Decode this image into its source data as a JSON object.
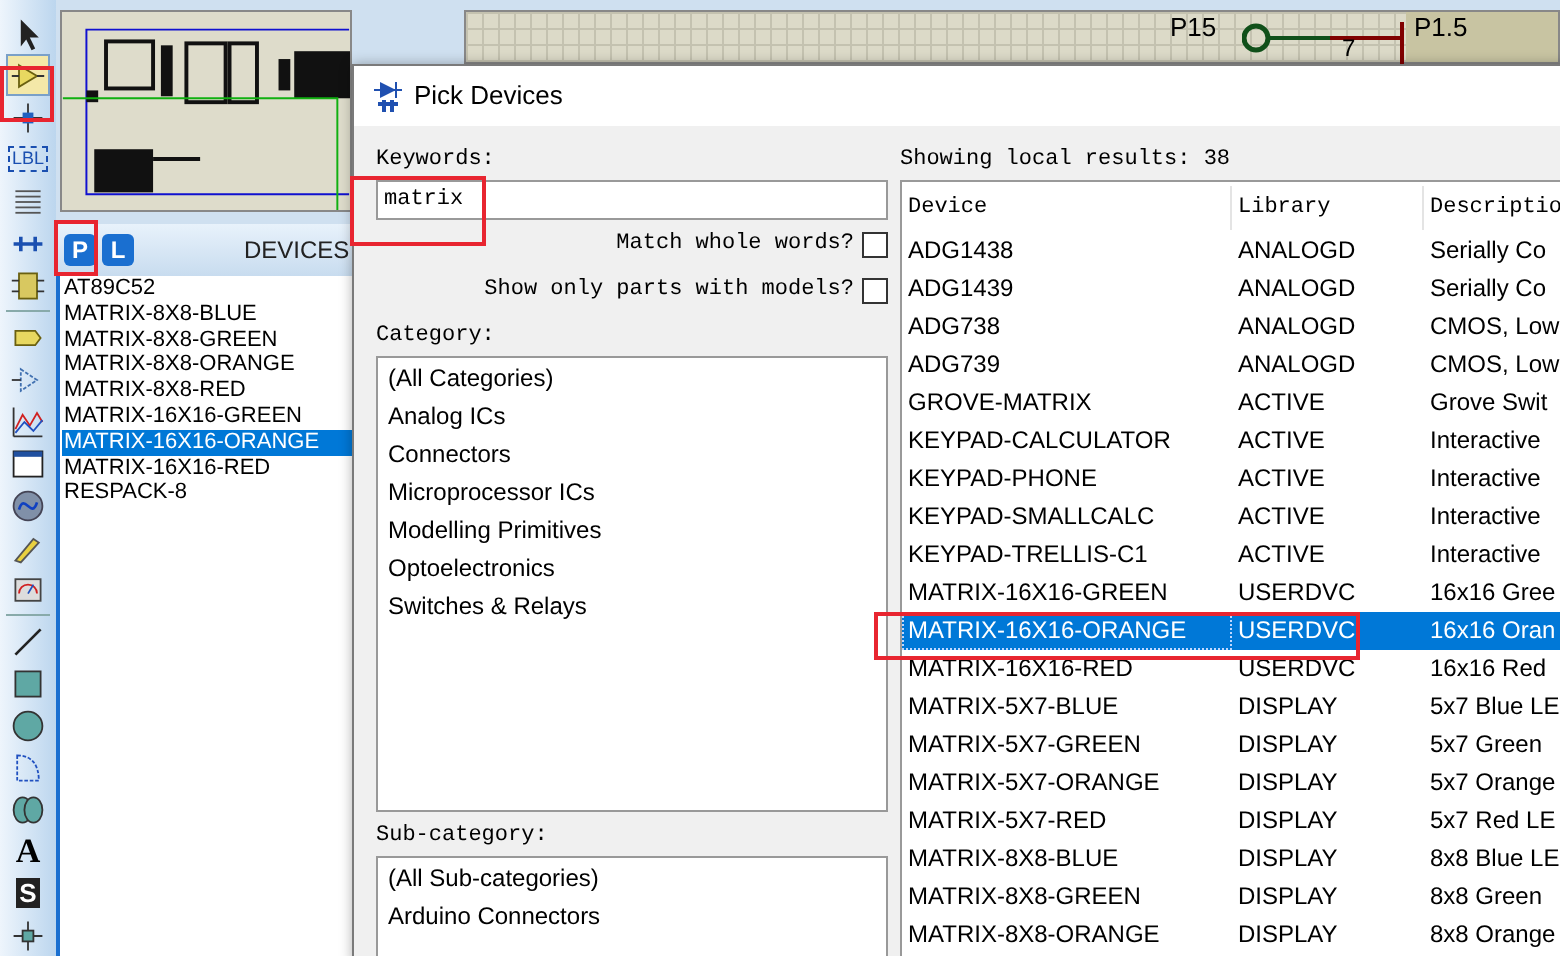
{
  "toolbar": {
    "items": [
      {
        "kind": "pointer",
        "selected": false
      },
      {
        "kind": "component",
        "selected": true
      },
      {
        "kind": "junction",
        "selected": false
      },
      {
        "kind": "label",
        "text": "LBL",
        "selected": false
      },
      {
        "kind": "script",
        "selected": false
      },
      {
        "kind": "bus",
        "selected": false
      },
      {
        "kind": "subcircuit",
        "selected": false
      },
      {
        "kind": "separator"
      },
      {
        "kind": "terminal",
        "selected": false
      },
      {
        "kind": "port",
        "selected": false
      },
      {
        "kind": "graph",
        "selected": false
      },
      {
        "kind": "tape",
        "selected": false
      },
      {
        "kind": "generator",
        "selected": false
      },
      {
        "kind": "probe",
        "selected": false
      },
      {
        "kind": "instrument",
        "selected": false
      },
      {
        "kind": "separator"
      },
      {
        "kind": "line",
        "selected": false
      },
      {
        "kind": "box",
        "selected": false
      },
      {
        "kind": "circle",
        "selected": false
      },
      {
        "kind": "arc",
        "selected": false
      },
      {
        "kind": "path",
        "selected": false
      },
      {
        "kind": "text",
        "text": "A",
        "selected": false
      },
      {
        "kind": "symbol",
        "text": "S",
        "selected": false
      },
      {
        "kind": "marker",
        "selected": false
      }
    ]
  },
  "devices_panel": {
    "buttons": [
      "P",
      "L"
    ],
    "title": "DEVICES",
    "items": [
      {
        "label": "AT89C52",
        "selected": false
      },
      {
        "label": "MATRIX-8X8-BLUE",
        "selected": false
      },
      {
        "label": "MATRIX-8X8-GREEN",
        "selected": false
      },
      {
        "label": "MATRIX-8X8-ORANGE",
        "selected": false
      },
      {
        "label": "MATRIX-8X8-RED",
        "selected": false
      },
      {
        "label": "MATRIX-16X16-GREEN",
        "selected": false
      },
      {
        "label": "MATRIX-16X16-ORANGE",
        "selected": true
      },
      {
        "label": "MATRIX-16X16-RED",
        "selected": false
      },
      {
        "label": "RESPACK-8",
        "selected": false
      }
    ]
  },
  "schematic": {
    "pin_label": "P15",
    "pin_number": "7",
    "net_label": "P1.5"
  },
  "dialog": {
    "title": "Pick Devices",
    "keywords_label": "Keywords:",
    "keywords_value": "matrix",
    "options": [
      {
        "label": "Match whole words?",
        "checked": false
      },
      {
        "label": "Show only parts with models?",
        "checked": false
      }
    ],
    "category_label": "Category:",
    "categories": [
      "(All Categories)",
      "Analog ICs",
      "Connectors",
      "Microprocessor ICs",
      "Modelling Primitives",
      "Optoelectronics",
      "Switches & Relays"
    ],
    "subcategory_label": "Sub-category:",
    "subcategories": [
      "(All Sub-categories)",
      "Arduino Connectors"
    ],
    "results_label": "Showing local results: 38",
    "table": {
      "columns": [
        "Device",
        "Library",
        "Descriptio"
      ],
      "rows": [
        {
          "cells": [
            "ADG1438",
            "ANALOGD",
            "Serially Co"
          ],
          "selected": false
        },
        {
          "cells": [
            "ADG1439",
            "ANALOGD",
            "Serially Co"
          ],
          "selected": false
        },
        {
          "cells": [
            "ADG738",
            "ANALOGD",
            "CMOS, Low"
          ],
          "selected": false
        },
        {
          "cells": [
            "ADG739",
            "ANALOGD",
            "CMOS, Low"
          ],
          "selected": false
        },
        {
          "cells": [
            "GROVE-MATRIX",
            "ACTIVE",
            "Grove Swit"
          ],
          "selected": false
        },
        {
          "cells": [
            "KEYPAD-CALCULATOR",
            "ACTIVE",
            "Interactive"
          ],
          "selected": false
        },
        {
          "cells": [
            "KEYPAD-PHONE",
            "ACTIVE",
            "Interactive"
          ],
          "selected": false
        },
        {
          "cells": [
            "KEYPAD-SMALLCALC",
            "ACTIVE",
            "Interactive"
          ],
          "selected": false
        },
        {
          "cells": [
            "KEYPAD-TRELLIS-C1",
            "ACTIVE",
            "Interactive"
          ],
          "selected": false
        },
        {
          "cells": [
            "MATRIX-16X16-GREEN",
            "USERDVC",
            "16x16 Gree"
          ],
          "selected": false
        },
        {
          "cells": [
            "MATRIX-16X16-ORANGE",
            "USERDVC",
            "16x16 Oran"
          ],
          "selected": true
        },
        {
          "cells": [
            "MATRIX-16X16-RED",
            "USERDVC",
            "16x16 Red"
          ],
          "selected": false
        },
        {
          "cells": [
            "MATRIX-5X7-BLUE",
            "DISPLAY",
            "5x7 Blue LE"
          ],
          "selected": false
        },
        {
          "cells": [
            "MATRIX-5X7-GREEN",
            "DISPLAY",
            "5x7 Green"
          ],
          "selected": false
        },
        {
          "cells": [
            "MATRIX-5X7-ORANGE",
            "DISPLAY",
            "5x7 Orange"
          ],
          "selected": false
        },
        {
          "cells": [
            "MATRIX-5X7-RED",
            "DISPLAY",
            "5x7 Red LE"
          ],
          "selected": false
        },
        {
          "cells": [
            "MATRIX-8X8-BLUE",
            "DISPLAY",
            "8x8 Blue LE"
          ],
          "selected": false
        },
        {
          "cells": [
            "MATRIX-8X8-GREEN",
            "DISPLAY",
            "8x8 Green"
          ],
          "selected": false
        },
        {
          "cells": [
            "MATRIX-8X8-ORANGE",
            "DISPLAY",
            "8x8 Orange"
          ],
          "selected": false
        }
      ]
    }
  }
}
